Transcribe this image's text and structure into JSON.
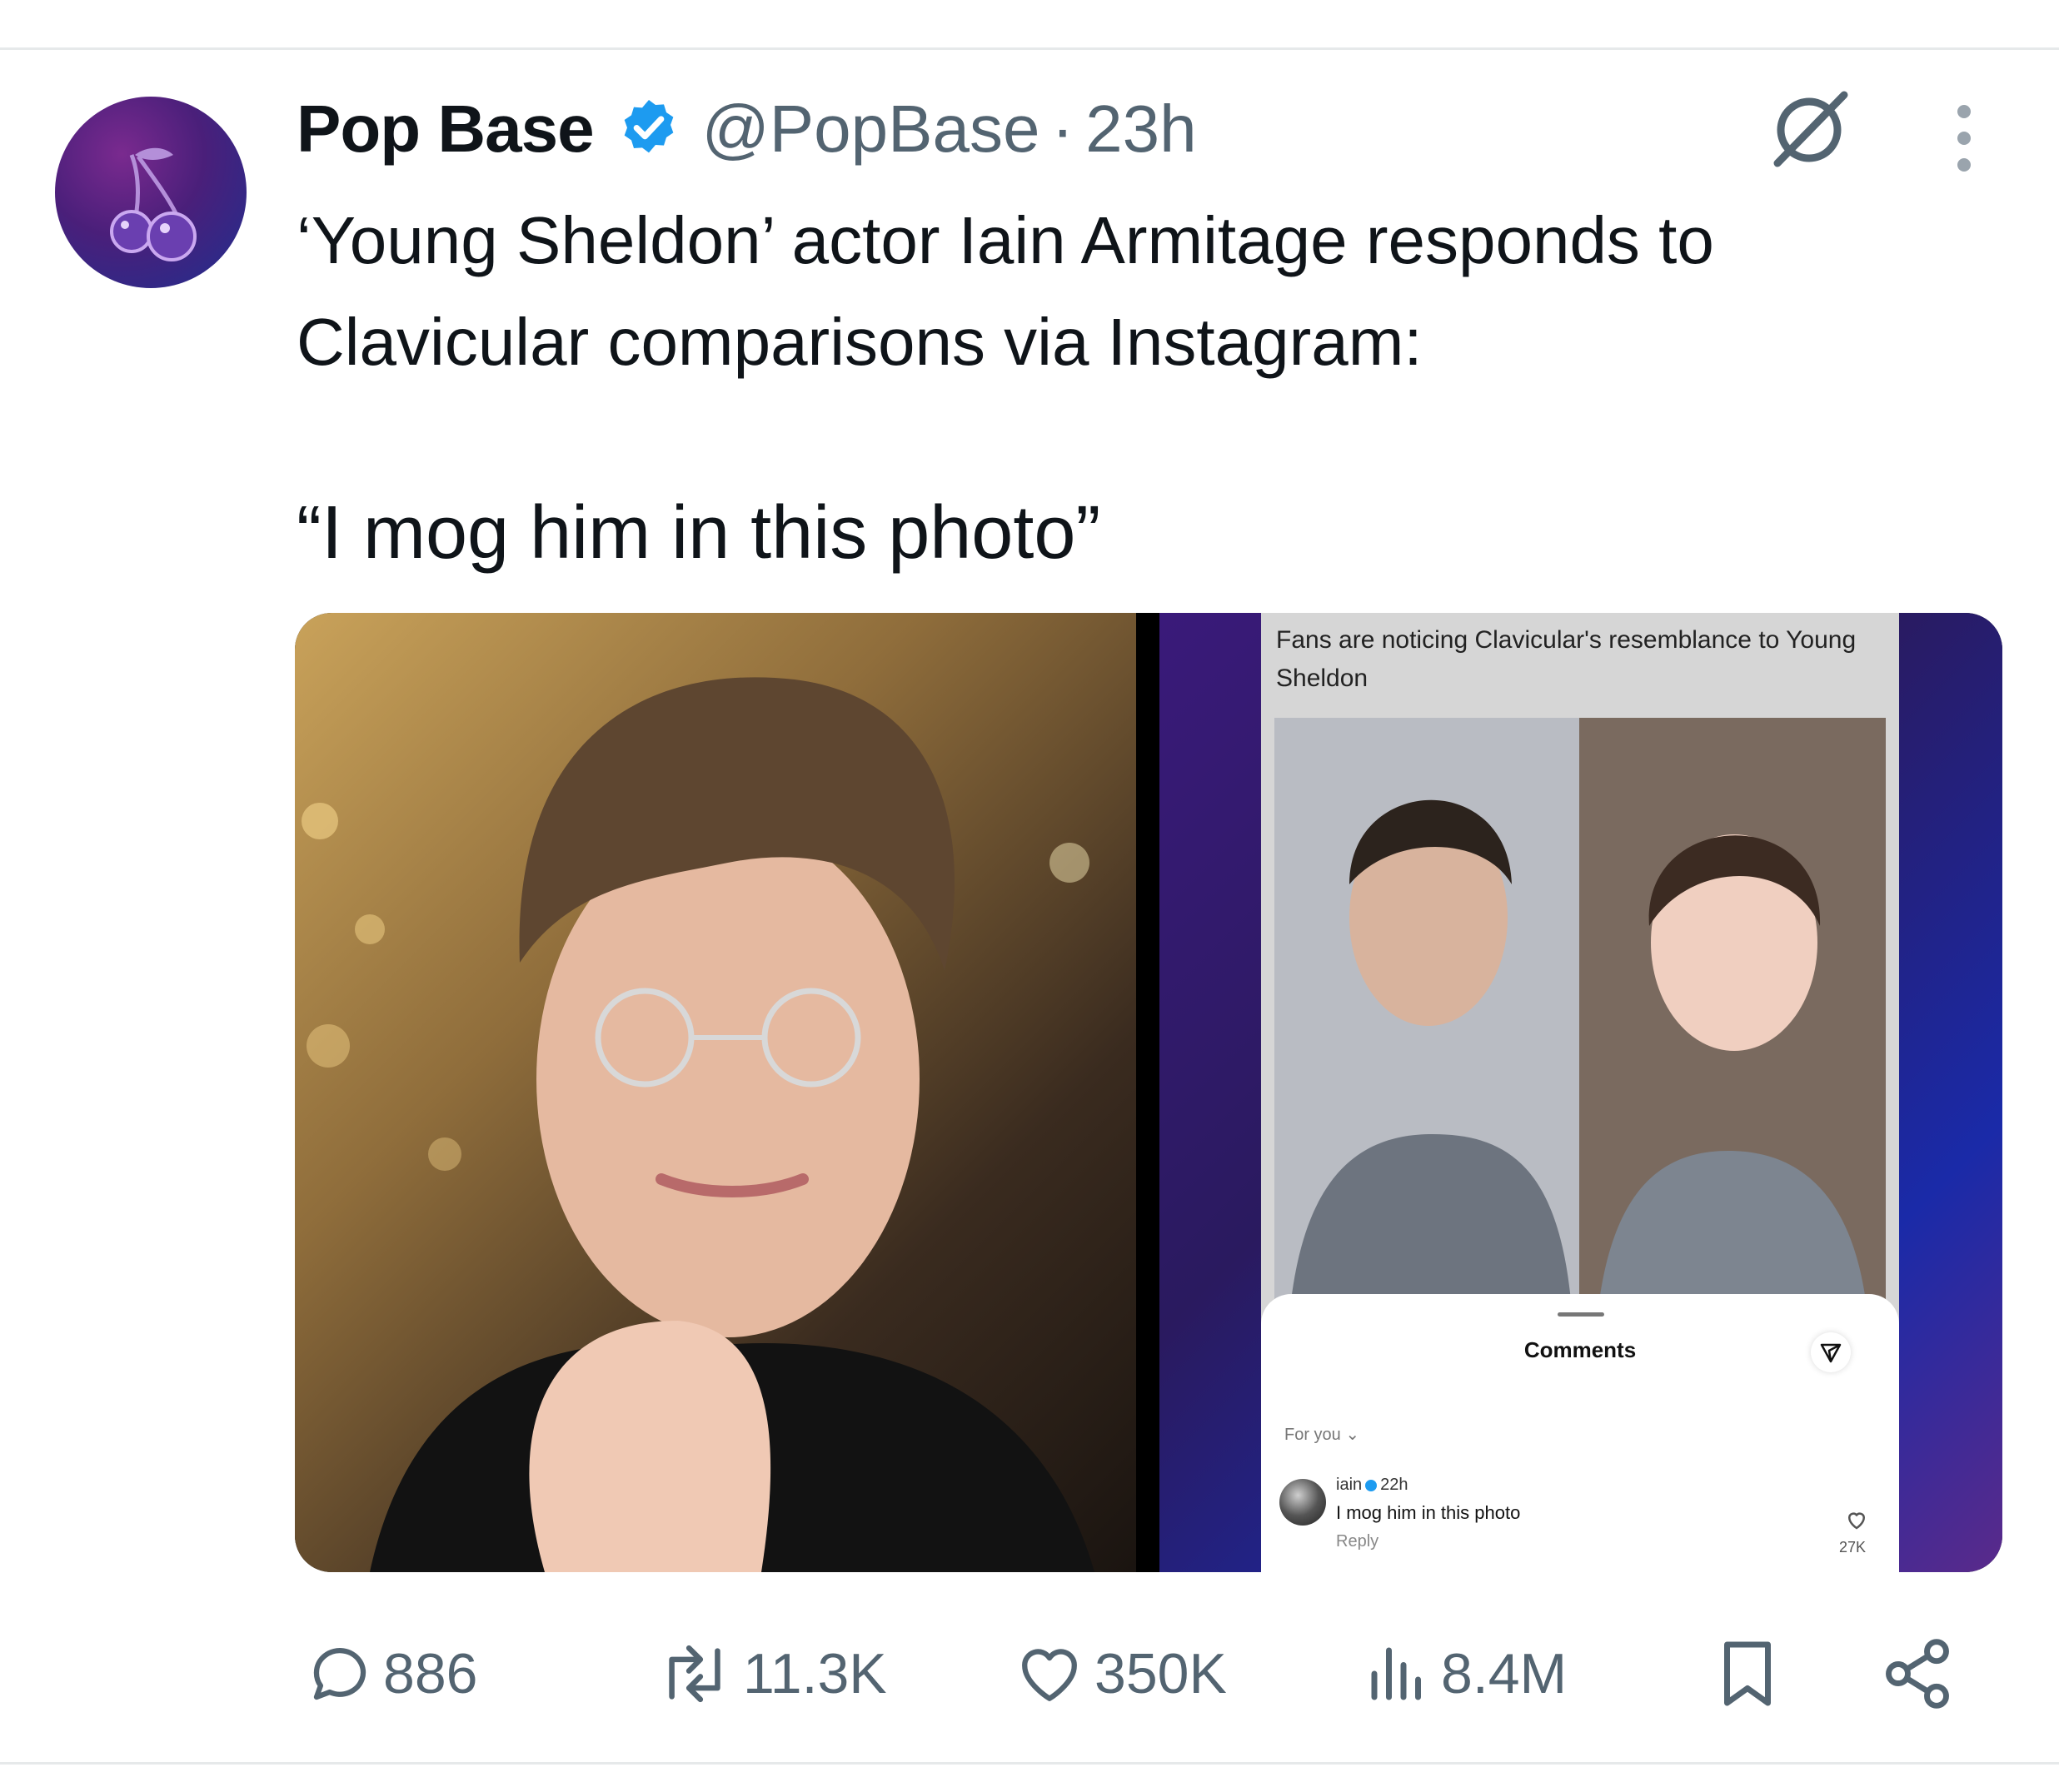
{
  "author": {
    "name": "Pop Base",
    "handle": "@PopBase",
    "separator": "·",
    "timestamp": "23h",
    "verified": true,
    "avatar_icon": "cherries-icon"
  },
  "tweet": {
    "line1": "‘Young Sheldon’ actor Iain Armitage responds to Clavicular comparisons via Instagram:",
    "quote": "“I mog him in this photo”"
  },
  "media": {
    "right_image": {
      "caption": "Fans are noticing Clavicular's resemblance to Young Sheldon",
      "comments_title": "Comments",
      "filter_label": "For you ⌄",
      "comment": {
        "user": "iain",
        "time": "22h",
        "text": "I mog him in this photo",
        "reply_label": "Reply",
        "likes": "27K"
      }
    }
  },
  "actions": {
    "replies": "886",
    "reposts": "11.3K",
    "likes": "350K",
    "views": "8.4M"
  },
  "colors": {
    "text_primary": "#0f1419",
    "text_secondary": "#536471",
    "verified_blue": "#1d9bf0",
    "divider": "#e6e9ea"
  }
}
